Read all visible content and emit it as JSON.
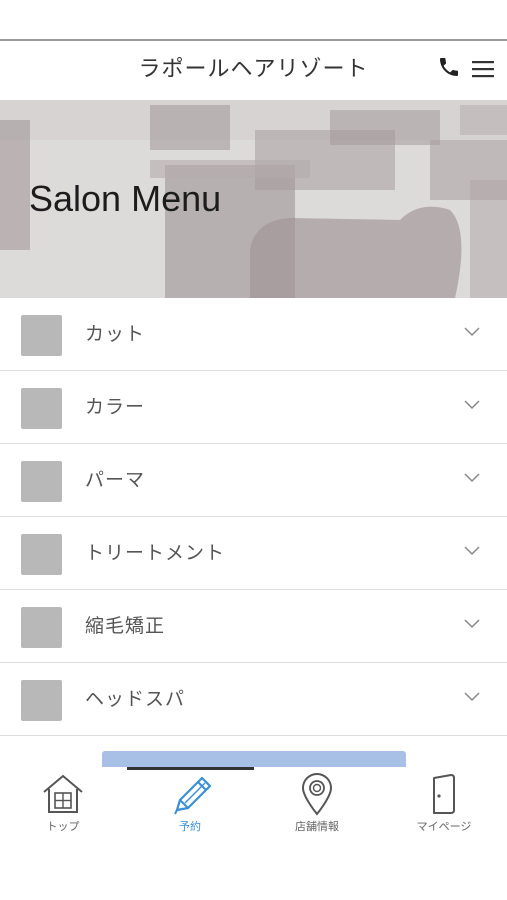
{
  "header": {
    "title": "ラポールヘアリゾート",
    "phone_icon": "phone-icon",
    "menu_icon": "hamburger-menu-icon"
  },
  "hero": {
    "title": "Salon Menu"
  },
  "menu": {
    "items": [
      {
        "label": "カット"
      },
      {
        "label": "カラー"
      },
      {
        "label": "パーマ"
      },
      {
        "label": "トリートメント"
      },
      {
        "label": "縮毛矯正"
      },
      {
        "label": "ヘッドスパ"
      }
    ],
    "chevron_icon": "chevron-down-icon"
  },
  "tabbar": {
    "tabs": [
      {
        "label": "トップ",
        "icon": "home-icon"
      },
      {
        "label": "予約",
        "icon": "pencil-icon",
        "active": true
      },
      {
        "label": "店舗情報",
        "icon": "map-pin-icon"
      },
      {
        "label": "マイページ",
        "icon": "door-icon"
      }
    ]
  },
  "colors": {
    "accent": "#3a8fd6",
    "reserve_button": "#a9c0e6",
    "thumb": "#b8b8b8"
  }
}
